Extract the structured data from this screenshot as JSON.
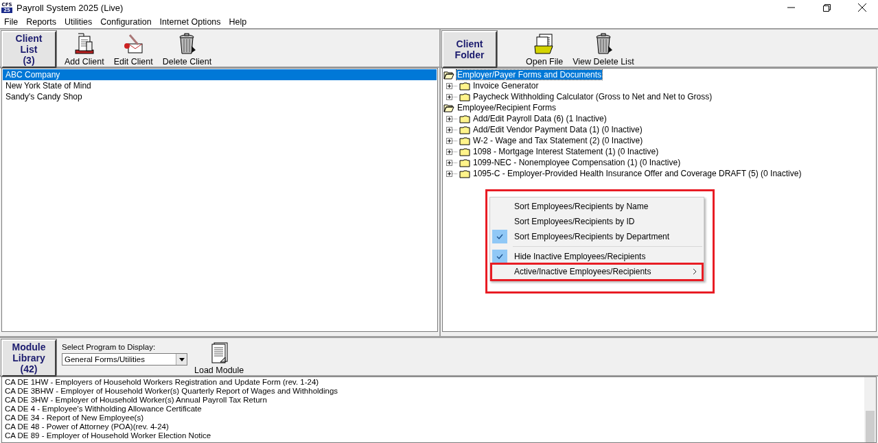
{
  "window": {
    "title": "Payroll System 2025 (Live)",
    "logo_lines": [
      "CFS",
      "25"
    ]
  },
  "menu_bar": [
    "File",
    "Reports",
    "Utilities",
    "Configuration",
    "Internet Options",
    "Help"
  ],
  "client_panel": {
    "header_lines": [
      "Client",
      "List",
      "(3)"
    ],
    "toolbar": [
      {
        "label": "Add Client",
        "kind": "add"
      },
      {
        "label": "Edit Client",
        "kind": "edit"
      },
      {
        "label": "Delete Client",
        "kind": "trash"
      }
    ],
    "clients": [
      {
        "name": "ABC Company",
        "selected": true
      },
      {
        "name": "New York State of Mind",
        "selected": false
      },
      {
        "name": "Sandy's Candy Shop",
        "selected": false
      }
    ]
  },
  "folder_panel": {
    "header_lines": [
      "Client",
      "Folder"
    ],
    "toolbar": [
      {
        "label": "Open File",
        "kind": "folder"
      },
      {
        "label": "View Delete List",
        "kind": "trash"
      }
    ],
    "tree": [
      {
        "label": "Employer/Payer Forms and Documents",
        "selected": true,
        "children": [
          {
            "label": "Invoice Generator"
          },
          {
            "label": "Paycheck Withholding Calculator (Gross to Net and Net to Gross)"
          }
        ]
      },
      {
        "label": "Employee/Recipient Forms",
        "selected": false,
        "children": [
          {
            "label": "Add/Edit Payroll Data  (6) (1 Inactive)"
          },
          {
            "label": "Add/Edit Vendor Payment Data  (1) (0 Inactive)"
          },
          {
            "label": "W-2 - Wage and Tax Statement  (2) (0 Inactive)"
          },
          {
            "label": "1098 - Mortgage Interest Statement  (1) (0 Inactive)"
          },
          {
            "label": "1099-NEC - Nonemployee Compensation  (1) (0 Inactive)"
          },
          {
            "label": "1095-C - Employer-Provided Health Insurance Offer and Coverage DRAFT  (5) (0 Inactive)"
          }
        ]
      }
    ]
  },
  "context_menu": {
    "items": [
      {
        "kind": "option",
        "label": "Sort Employees/Recipients by Name",
        "checked": false,
        "submenu": false,
        "highlighted": false
      },
      {
        "kind": "option",
        "label": "Sort Employees/Recipients by ID",
        "checked": false,
        "submenu": false,
        "highlighted": false
      },
      {
        "kind": "option",
        "label": "Sort Employees/Recipients by Department",
        "checked": true,
        "submenu": false,
        "highlighted": false
      },
      {
        "kind": "separator"
      },
      {
        "kind": "option",
        "label": "Hide Inactive Employees/Recipients",
        "checked": true,
        "submenu": false,
        "highlighted": false
      },
      {
        "kind": "option",
        "label": "Active/Inactive Employees/Recipients",
        "checked": false,
        "submenu": true,
        "highlighted": true
      }
    ]
  },
  "module_panel": {
    "header_lines": [
      "Module",
      "Library",
      "(42)"
    ],
    "select_label": "Select Program to Display:",
    "select_value": "General Forms/Utilities",
    "load_label": "Load Module",
    "modules": [
      "CA DE 1HW - Employers of Household Workers Registration and Update Form (rev. 1-24)",
      "CA DE 3BHW - Employer of Household Worker(s) Quarterly Report of Wages and Withholdings",
      "CA DE 3HW - Employer of Household Worker(s) Annual Payroll Tax Return",
      "CA DE 4 - Employee's Withholding Allowance Certificate",
      "CA DE 34 - Report of New Employee(s)",
      "CA DE 48 - Power of Attorney (POA)(rev. 4-24)",
      "CA DE 89 - Employer of Household Worker Election Notice"
    ]
  }
}
